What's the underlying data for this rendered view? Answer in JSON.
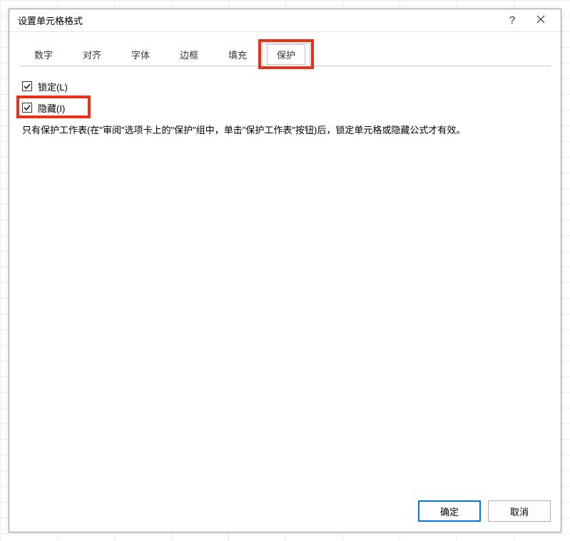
{
  "dialog": {
    "title": "设置单元格格式",
    "help_symbol": "?"
  },
  "tabs": {
    "number": "数字",
    "alignment": "对齐",
    "font": "字体",
    "border": "边框",
    "fill": "填充",
    "protection": "保护"
  },
  "protection_panel": {
    "locked_label": "锁定(L)",
    "hidden_label": "隐藏(I)",
    "locked_checked": true,
    "hidden_checked": true,
    "instructions": "只有保护工作表(在\"审阅\"选项卡上的\"保护\"组中，单击\"保护工作表\"按钮)后，锁定单元格或隐藏公式才有效。"
  },
  "buttons": {
    "ok": "确定",
    "cancel": "取消"
  },
  "highlight_color": "#e8311a"
}
